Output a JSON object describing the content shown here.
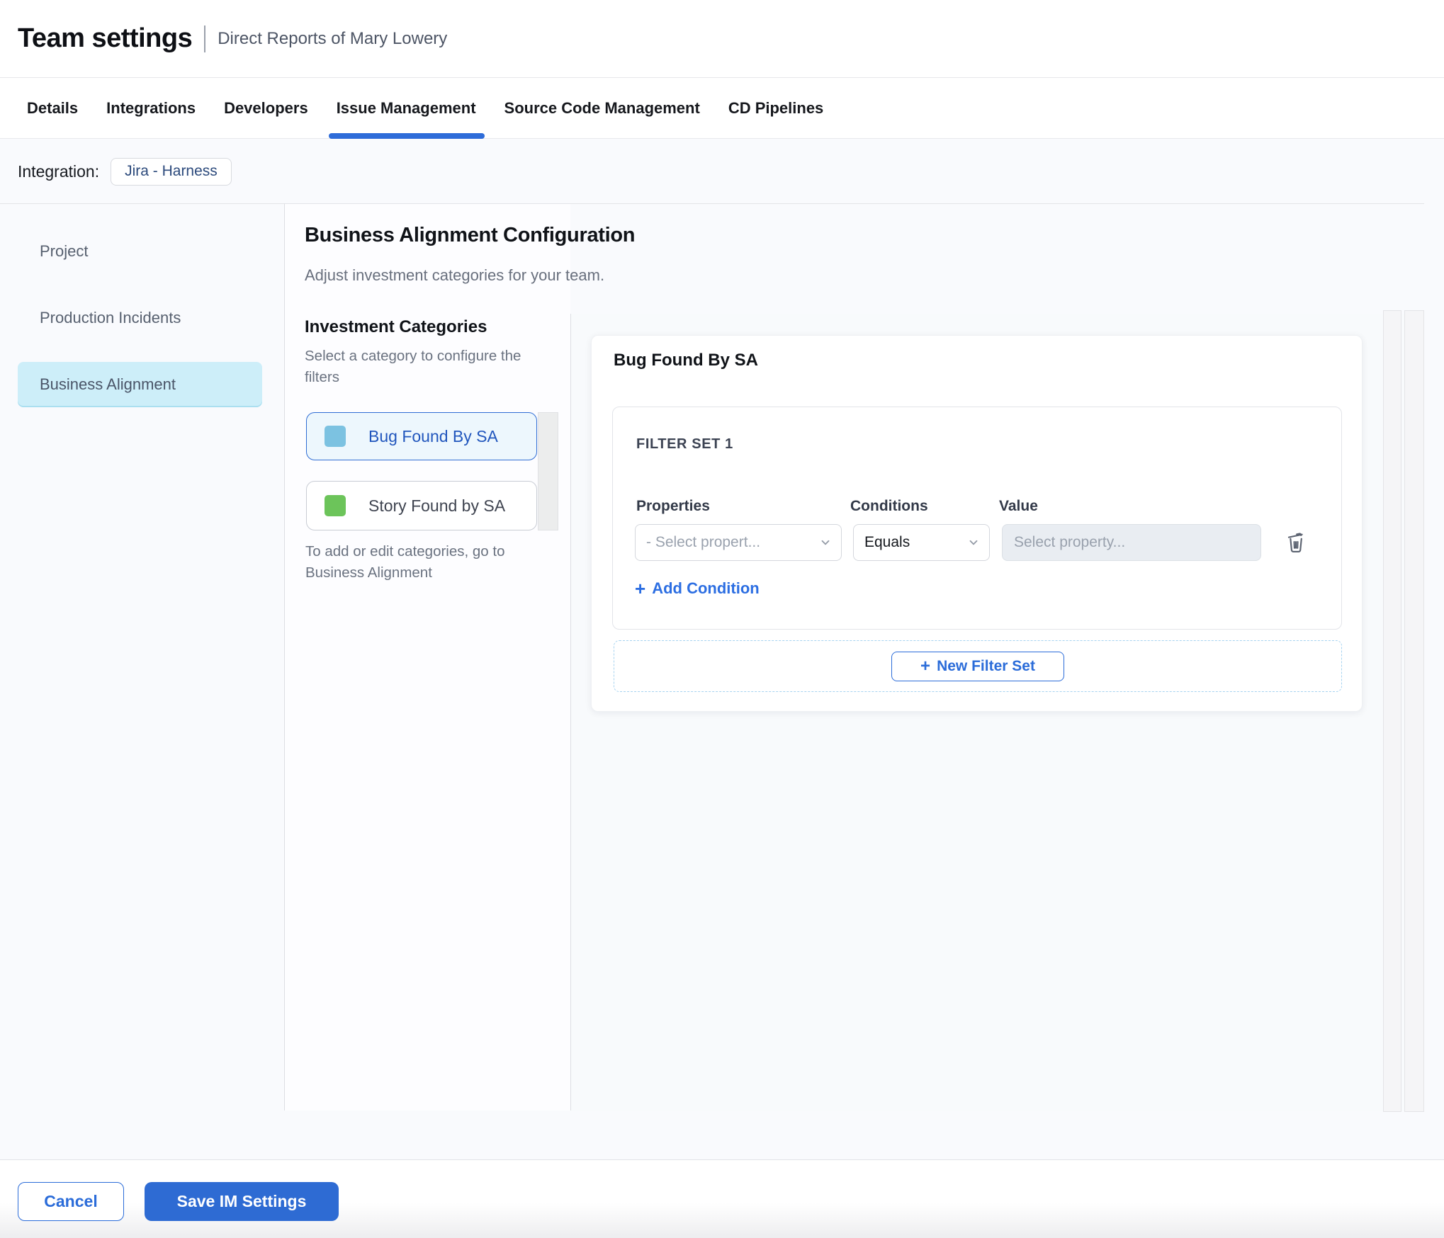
{
  "header": {
    "title": "Team settings",
    "subtitle": "Direct Reports of Mary Lowery"
  },
  "tabs": [
    {
      "label": "Details",
      "active": false
    },
    {
      "label": "Integrations",
      "active": false
    },
    {
      "label": "Developers",
      "active": false
    },
    {
      "label": "Issue Management",
      "active": true
    },
    {
      "label": "Source Code Management",
      "active": false
    },
    {
      "label": "CD Pipelines",
      "active": false
    }
  ],
  "integration": {
    "label": "Integration:",
    "badge": "Jira - Harness"
  },
  "sidebar": {
    "items": [
      {
        "label": "Project",
        "selected": false
      },
      {
        "label": "Production Incidents",
        "selected": false
      },
      {
        "label": "Business Alignment",
        "selected": true
      }
    ]
  },
  "main": {
    "heading": "Business Alignment Configuration",
    "subheading": "Adjust investment categories for your team.",
    "investment_categories": {
      "title": "Investment Categories",
      "subtitle": "Select a category to configure the filters",
      "items": [
        {
          "label": "Bug Found By SA",
          "swatch_color": "#7cc2e1",
          "selected": true
        },
        {
          "label": "Story Found by SA",
          "swatch_color": "#6cc45a",
          "selected": false
        }
      ],
      "note": "To add or edit categories, go to Business Alignment"
    },
    "panel": {
      "title": "Bug Found By SA",
      "filter_set": {
        "title": "FILTER SET 1",
        "columns": {
          "properties": "Properties",
          "conditions": "Conditions",
          "value": "Value"
        },
        "row": {
          "property_placeholder": "- Select propert...",
          "condition_selected": "Equals",
          "value_placeholder": "Select property..."
        },
        "add_condition_label": "Add Condition"
      },
      "new_filter_set_label": "New Filter Set"
    }
  },
  "footer": {
    "cancel_label": "Cancel",
    "save_label": "Save IM Settings"
  },
  "colors": {
    "accent_blue": "#2b6cd9",
    "link_blue": "#2c6ee2",
    "selected_nav_bg": "#cdeef9",
    "selected_category_bg": "#edf7fd",
    "bug_swatch": "#7cc2e1",
    "story_swatch": "#6cc45a"
  }
}
